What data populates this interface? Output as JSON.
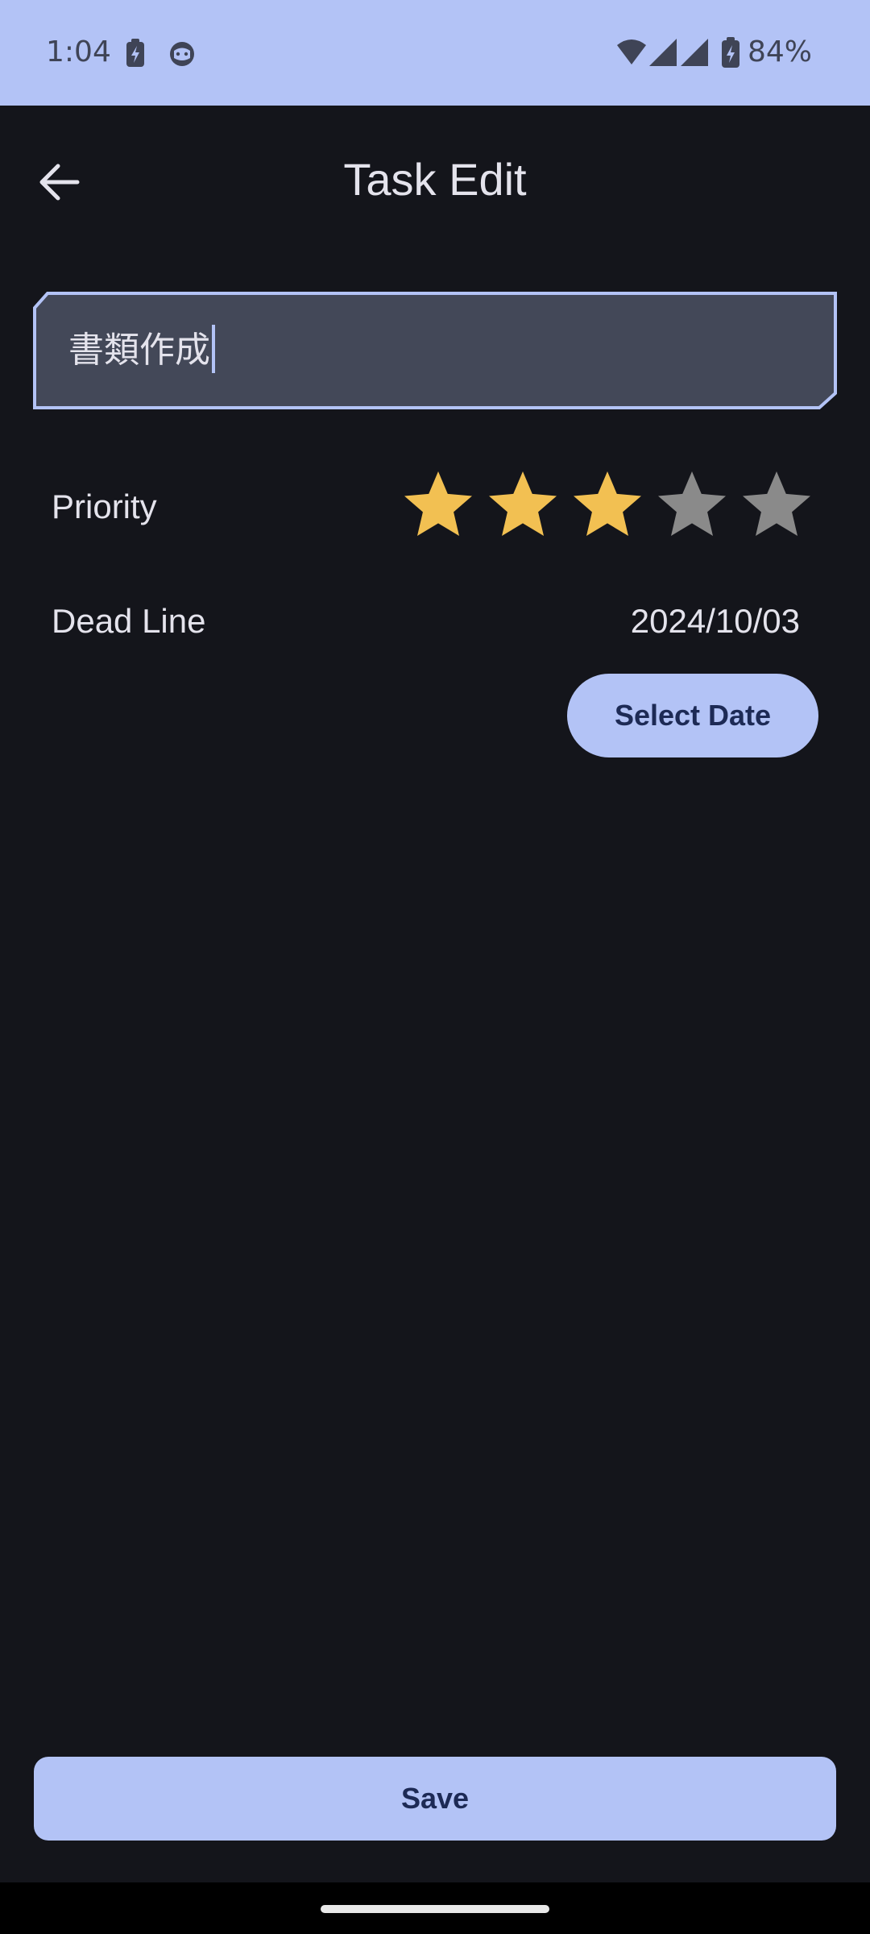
{
  "status_bar": {
    "time": "1:04",
    "battery_percent": "84%",
    "icons": [
      "battery-saver-icon",
      "cat-face-icon",
      "wifi-icon",
      "signal-icon",
      "signal-icon",
      "battery-charging-icon"
    ]
  },
  "header": {
    "title": "Task Edit",
    "back_icon": "arrow-left-icon"
  },
  "task": {
    "name_value": "書類作成"
  },
  "priority": {
    "label": "Priority",
    "rating": 3,
    "max": 5,
    "filled_color": "#f2c052",
    "empty_color": "#8a8a8a"
  },
  "deadline": {
    "label": "Dead Line",
    "value": "2024/10/03",
    "select_button_label": "Select Date"
  },
  "footer": {
    "save_label": "Save"
  },
  "colors": {
    "background": "#14151b",
    "status_bar": "#b3c3f6",
    "accent": "#b3c3f6",
    "accent_text": "#1d2a55",
    "input_fill": "#434858"
  }
}
